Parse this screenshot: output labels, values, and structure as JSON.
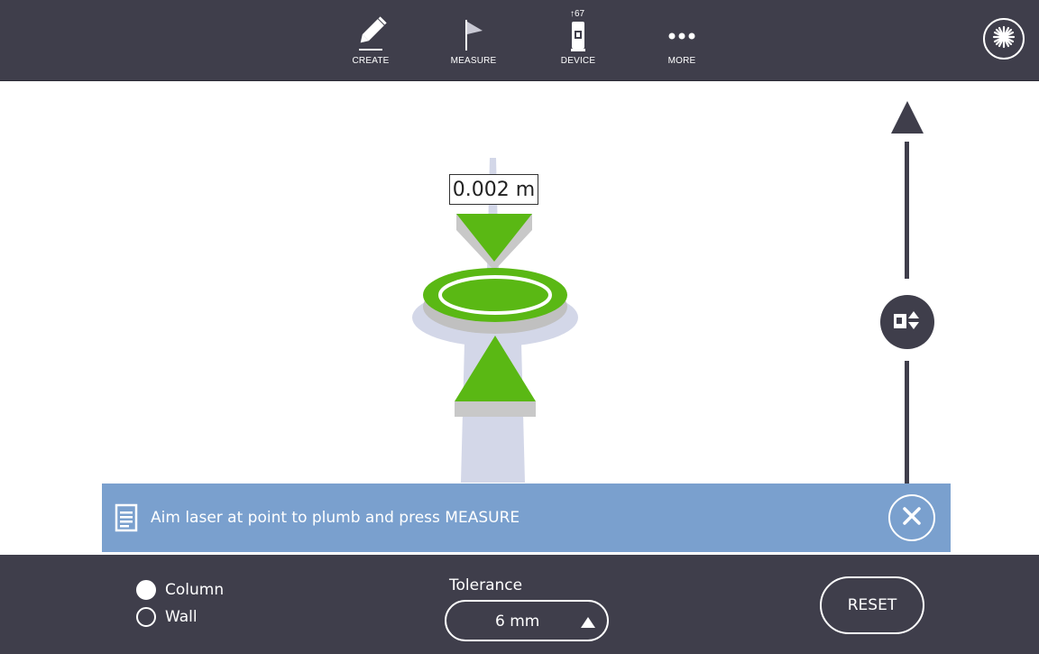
{
  "toolbar": {
    "items": [
      {
        "label": "CREATE",
        "icon": "pencil-icon"
      },
      {
        "label": "MEASURE",
        "icon": "flag-icon"
      },
      {
        "label": "DEVICE",
        "icon": "total-station-icon",
        "badge": "67"
      },
      {
        "label": "MORE",
        "icon": "more-dots-icon"
      }
    ],
    "laser_icon": "laser-starburst-icon"
  },
  "view": {
    "measurement": "0.002 m",
    "nudge_icon": "device-up-down-icon"
  },
  "message": {
    "text": "Aim laser at point to plumb and press MEASURE",
    "icon": "document-icon",
    "close_icon": "close-icon"
  },
  "bottom": {
    "mode_options": [
      {
        "label": "Column",
        "selected": true
      },
      {
        "label": "Wall",
        "selected": false
      }
    ],
    "tolerance": {
      "label": "Tolerance",
      "value": "6 mm"
    },
    "reset_label": "RESET"
  },
  "colors": {
    "bar": "#3f3e4b",
    "target_green": "#5ab814",
    "message_bg": "#7aa0ce",
    "beam": "#d3d7e8"
  }
}
